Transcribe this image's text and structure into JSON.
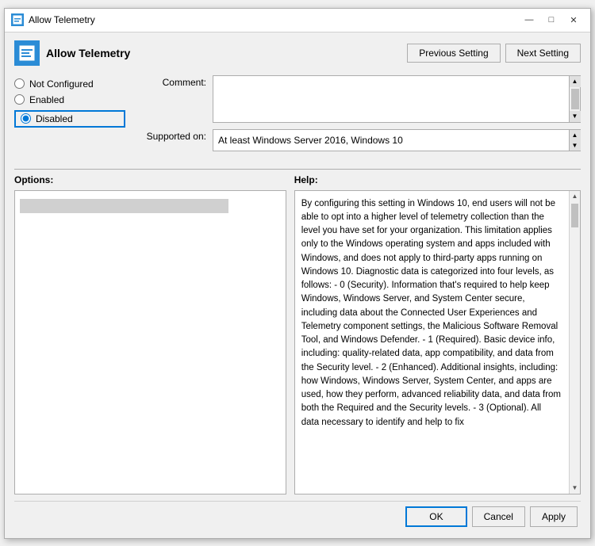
{
  "window": {
    "title": "Allow Telemetry",
    "title_bar_icon": "settings-icon"
  },
  "title_bar_controls": {
    "minimize": "—",
    "maximize": "□",
    "close": "✕"
  },
  "header": {
    "icon": "policy-icon",
    "title": "Allow Telemetry"
  },
  "toolbar": {
    "previous_label": "Previous Setting",
    "next_label": "Next Setting"
  },
  "radio_options": {
    "not_configured_label": "Not Configured",
    "enabled_label": "Enabled",
    "disabled_label": "Disabled",
    "selected": "disabled"
  },
  "comment_field": {
    "label": "Comment:",
    "value": ""
  },
  "supported_on": {
    "label": "Supported on:",
    "value": "At least Windows Server 2016, Windows 10"
  },
  "sections": {
    "options_title": "Options:",
    "help_title": "Help:"
  },
  "help_text": "By configuring this setting in Windows 10, end users will not be able to opt into a higher level of telemetry collection than the level you have set for your organization.  This limitation applies only to the Windows operating system and apps included with Windows, and does not apply to third-party apps running on Windows 10.\n\nDiagnostic data is categorized into four levels, as follows:\n  - 0 (Security). Information that's required to help keep Windows, Windows Server, and System Center secure, including data about the Connected User Experiences and Telemetry component settings, the Malicious Software Removal Tool, and Windows Defender.\n  - 1 (Required). Basic device info, including: quality-related data, app compatibility, and data from the Security level.\n  - 2 (Enhanced). Additional insights, including: how Windows, Windows Server, System Center, and apps are used, how they perform, advanced reliability data, and data from both the Required and the Security levels.\n  - 3 (Optional). All data necessary to identify and help to fix",
  "footer": {
    "ok_label": "OK",
    "cancel_label": "Cancel",
    "apply_label": "Apply"
  }
}
